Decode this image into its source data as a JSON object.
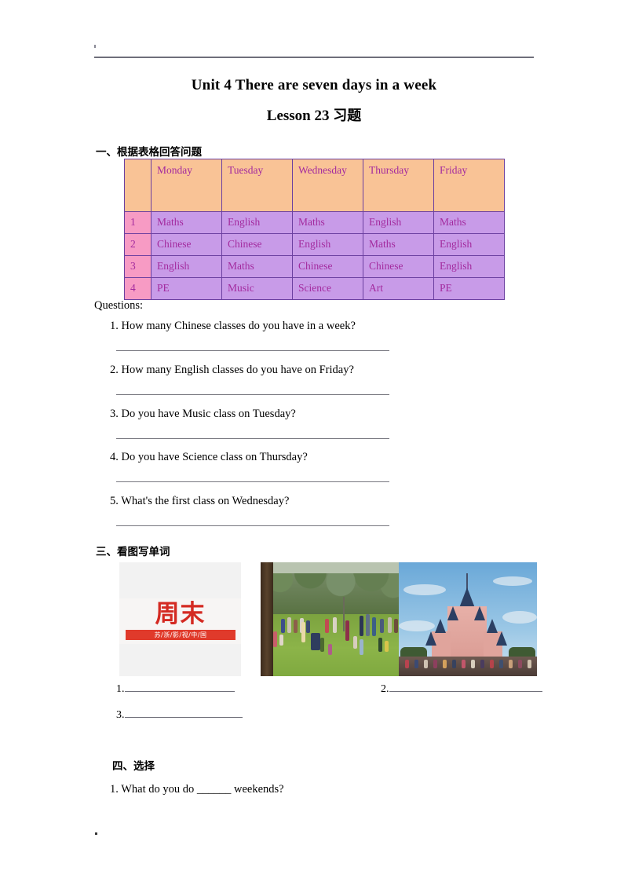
{
  "document": {
    "title_line1": "Unit 4 There are seven days in a week",
    "title_line2_en": "Lesson 23 ",
    "title_line2_cn": "习题"
  },
  "section_one": {
    "heading": "一、根据表格回答问题",
    "table": {
      "corner_label": "",
      "columns": [
        "Monday",
        "Tuesday",
        "Wednesday",
        "Thursday",
        "Friday"
      ],
      "rows": [
        {
          "num": "1",
          "cells": [
            "Maths",
            "English",
            "Maths",
            "English",
            "Maths"
          ]
        },
        {
          "num": "2",
          "cells": [
            "Chinese",
            "Chinese",
            "English",
            "Maths",
            "English"
          ]
        },
        {
          "num": "3",
          "cells": [
            "English",
            "Maths",
            "Chinese",
            "Chinese",
            "English"
          ]
        },
        {
          "num": "4",
          "cells": [
            "PE",
            "Music",
            "Science",
            "Art",
            "PE"
          ]
        }
      ],
      "colors": {
        "header_bg": "#f9c396",
        "rownum_bg": "#f79bc4",
        "cell_bg": "#c89be8",
        "text": "#a32a9e",
        "border": "#6b3fa0"
      }
    },
    "questions_label": "Questions:",
    "questions": [
      "1. How many Chinese classes do you have in a week?",
      "2. How many English classes do you have on Friday?",
      "3. Do you have Music class on Tuesday?",
      "4. Do you have Science class on Thursday?",
      "5. What's the first class on Wednesday?"
    ]
  },
  "section_three": {
    "heading": "三、看图写单词",
    "pictures": [
      {
        "name": "weekend-calendar-logo-image",
        "logo_text": "周末",
        "logo_subtitle": "苏/浙/影/视/中/国",
        "alt": "red chinese characters logo on light gray background"
      },
      {
        "name": "park-with-people-image",
        "alt": "people on green park lawn with trees"
      },
      {
        "name": "castle-theme-park-image",
        "alt": "pink fairytale castle under blue sky with crowd"
      }
    ],
    "blanks": [
      {
        "label": "1."
      },
      {
        "label": "2."
      },
      {
        "label": "3."
      }
    ]
  },
  "section_four": {
    "heading": "四、选择",
    "items": [
      "1. What do you do ______ weekends?"
    ]
  }
}
